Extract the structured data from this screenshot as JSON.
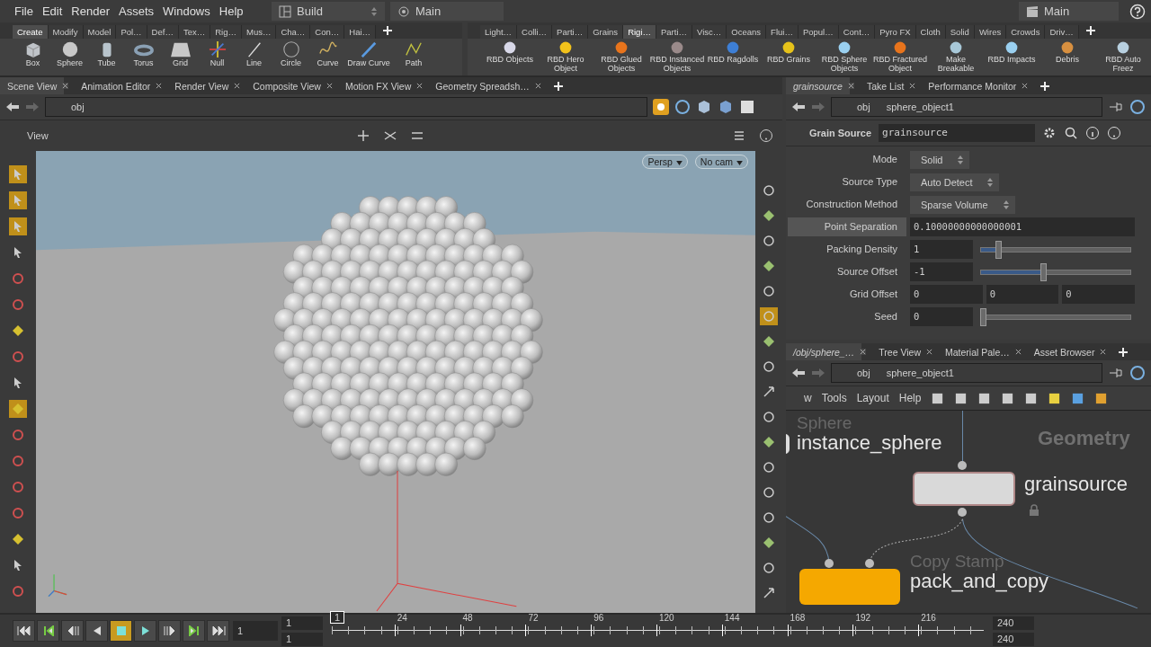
{
  "menu": [
    "File",
    "Edit",
    "Render",
    "Assets",
    "Windows",
    "Help"
  ],
  "desktop": "Build",
  "context": "Main",
  "right_desktop": "Main",
  "shelf_left": {
    "tabs": [
      {
        "label": "Create",
        "selected": true
      },
      {
        "label": "Modify",
        "selected": false
      },
      {
        "label": "Model",
        "selected": false
      },
      {
        "label": "Pol…",
        "selected": false
      },
      {
        "label": "Def…",
        "selected": false
      },
      {
        "label": "Tex…",
        "selected": false
      },
      {
        "label": "Rig…",
        "selected": false
      },
      {
        "label": "Mus…",
        "selected": false
      },
      {
        "label": "Cha…",
        "selected": false
      },
      {
        "label": "Con…",
        "selected": false
      },
      {
        "label": "Hai…",
        "selected": false
      }
    ],
    "tools": [
      "Box",
      "Sphere",
      "Tube",
      "Torus",
      "Grid",
      "Null",
      "Line",
      "Circle",
      "Curve",
      "Draw Curve",
      "Path"
    ]
  },
  "shelf_right": {
    "tabs": [
      {
        "label": "Light…",
        "selected": false
      },
      {
        "label": "Colli…",
        "selected": false
      },
      {
        "label": "Parti…",
        "selected": false
      },
      {
        "label": "Grains",
        "selected": false
      },
      {
        "label": "Rigi…",
        "selected": true
      },
      {
        "label": "Parti…",
        "selected": false
      },
      {
        "label": "Visc…",
        "selected": false
      },
      {
        "label": "Oceans",
        "selected": false
      },
      {
        "label": "Flui…",
        "selected": false
      },
      {
        "label": "Popul…",
        "selected": false
      },
      {
        "label": "Cont…",
        "selected": false
      },
      {
        "label": "Pyro FX",
        "selected": false
      },
      {
        "label": "Cloth",
        "selected": false
      },
      {
        "label": "Solid",
        "selected": false
      },
      {
        "label": "Wires",
        "selected": false
      },
      {
        "label": "Crowds",
        "selected": false
      },
      {
        "label": "Driv…",
        "selected": false
      }
    ],
    "tools": [
      "RBD Objects",
      "RBD Hero Object",
      "RBD Glued Objects",
      "RBD Instanced Objects",
      "RBD Ragdolls",
      "RBD Grains",
      "RBD Sphere Objects",
      "RBD Fractured Object",
      "Make Breakable",
      "RBD Impacts",
      "Debris",
      "RBD Auto Freez"
    ]
  },
  "scene_pane": {
    "tabs": [
      {
        "label": "Scene View",
        "selected": true
      },
      {
        "label": "Animation Editor",
        "selected": false
      },
      {
        "label": "Render View",
        "selected": false
      },
      {
        "label": "Composite View",
        "selected": false
      },
      {
        "label": "Motion FX View",
        "selected": false
      },
      {
        "label": "Geometry Spreadsh…",
        "selected": false
      }
    ],
    "path": "obj",
    "view_label": "View",
    "camera_buttons": [
      "Persp",
      "No cam"
    ]
  },
  "param_pane": {
    "tabs": [
      {
        "label": "grainsource",
        "selected": true
      },
      {
        "label": "Take List",
        "selected": false
      },
      {
        "label": "Performance Monitor",
        "selected": false
      }
    ],
    "path": [
      "obj",
      "sphere_object1"
    ],
    "node_type": "Grain Source",
    "node_name": "grainsource",
    "params": [
      {
        "label": "Mode",
        "kind": "menu",
        "value": "Solid",
        "highlighted": false
      },
      {
        "label": "Source Type",
        "kind": "menu",
        "value": "Auto Detect",
        "highlighted": false
      },
      {
        "label": "Construction Method",
        "kind": "menu",
        "value": "Sparse Volume",
        "highlighted": false
      },
      {
        "label": "Point Separation",
        "kind": "field",
        "value": "0.10000000000000001",
        "highlighted": true
      },
      {
        "label": "Packing Density",
        "kind": "slider",
        "value": "1",
        "level": 0.1,
        "highlighted": false
      },
      {
        "label": "Source Offset",
        "kind": "slider",
        "value": "-1",
        "level": 0.4,
        "highlighted": false
      },
      {
        "label": "Grid Offset",
        "kind": "vector",
        "values": [
          "0",
          "0",
          "0"
        ],
        "highlighted": false
      },
      {
        "label": "Seed",
        "kind": "slider",
        "value": "0",
        "level": 0,
        "highlighted": false
      }
    ]
  },
  "network_pane": {
    "tabs": [
      {
        "label": "/obj/sphere_…",
        "selected": true
      },
      {
        "label": "Tree View",
        "selected": false
      },
      {
        "label": "Material Pale…",
        "selected": false
      },
      {
        "label": "Asset Browser",
        "selected": false
      }
    ],
    "path": [
      "obj",
      "sphere_object1"
    ],
    "menu": [
      "w",
      "Tools",
      "Layout",
      "Help"
    ],
    "context_label": "Geometry",
    "nodes": [
      {
        "type": "Sphere",
        "name": "instance_sphere",
        "kind": "edge"
      },
      {
        "name": "grainsource",
        "kind": "plain",
        "locked": true
      },
      {
        "type": "Copy Stamp",
        "name": "pack_and_copy",
        "kind": "orange"
      }
    ]
  },
  "timeline": {
    "buttons": [
      {
        "kind": "first",
        "selected": false
      },
      {
        "kind": "prev-key",
        "selected": false
      },
      {
        "kind": "step-back",
        "selected": false
      },
      {
        "kind": "reverse",
        "selected": false
      },
      {
        "kind": "stop",
        "selected": true
      },
      {
        "kind": "play",
        "selected": false
      },
      {
        "kind": "step-forward",
        "selected": false
      },
      {
        "kind": "next-key",
        "selected": false
      },
      {
        "kind": "last",
        "selected": false
      }
    ],
    "current_frame": "1",
    "start": "1",
    "start_range": "1",
    "marker": "1",
    "ticks": [
      "24",
      "48",
      "72",
      "96",
      "120",
      "144",
      "168",
      "192",
      "216"
    ],
    "end": "240",
    "end_range": "240"
  }
}
